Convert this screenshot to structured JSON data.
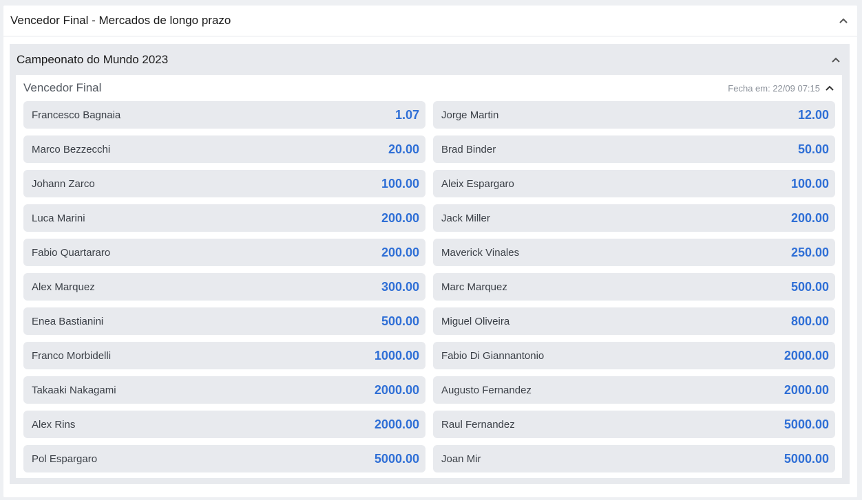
{
  "outer": {
    "title": "Vencedor Final - Mercados de longo prazo"
  },
  "section": {
    "title": "Campeonato do Mundo 2023"
  },
  "market": {
    "title": "Vencedor Final",
    "closes": "Fecha em: 22/09 07:15"
  },
  "selections": [
    {
      "name": "Francesco Bagnaia",
      "odd": "1.07"
    },
    {
      "name": "Jorge Martin",
      "odd": "12.00"
    },
    {
      "name": "Marco Bezzecchi",
      "odd": "20.00"
    },
    {
      "name": "Brad Binder",
      "odd": "50.00"
    },
    {
      "name": "Johann Zarco",
      "odd": "100.00"
    },
    {
      "name": "Aleix Espargaro",
      "odd": "100.00"
    },
    {
      "name": "Luca Marini",
      "odd": "200.00"
    },
    {
      "name": "Jack Miller",
      "odd": "200.00"
    },
    {
      "name": "Fabio Quartararo",
      "odd": "200.00"
    },
    {
      "name": "Maverick Vinales",
      "odd": "250.00"
    },
    {
      "name": "Alex Marquez",
      "odd": "300.00"
    },
    {
      "name": "Marc Marquez",
      "odd": "500.00"
    },
    {
      "name": "Enea Bastianini",
      "odd": "500.00"
    },
    {
      "name": "Miguel Oliveira",
      "odd": "800.00"
    },
    {
      "name": "Franco Morbidelli",
      "odd": "1000.00"
    },
    {
      "name": "Fabio Di Giannantonio",
      "odd": "2000.00"
    },
    {
      "name": "Takaaki Nakagami",
      "odd": "2000.00"
    },
    {
      "name": "Augusto Fernandez",
      "odd": "2000.00"
    },
    {
      "name": "Alex Rins",
      "odd": "2000.00"
    },
    {
      "name": "Raul Fernandez",
      "odd": "5000.00"
    },
    {
      "name": "Pol Espargaro",
      "odd": "5000.00"
    },
    {
      "name": "Joan Mir",
      "odd": "5000.00"
    }
  ],
  "colors": {
    "odd_text": "#2f6fd6",
    "button_bg": "#e8eaee",
    "page_bg": "#eef0f3"
  },
  "icons": {
    "collapse": "chevron-up-icon"
  }
}
